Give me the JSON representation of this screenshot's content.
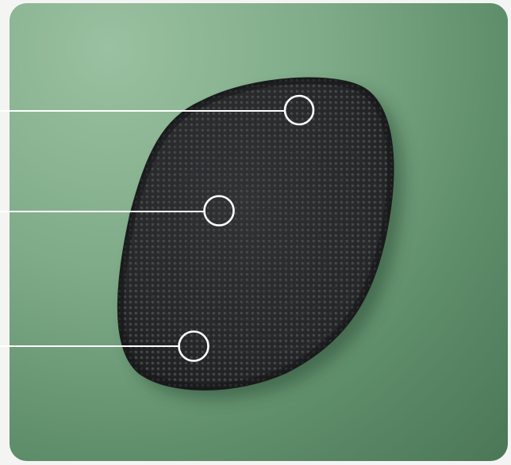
{
  "scene": {
    "subject": "scrubber-pad-icon",
    "colors": {
      "background_light": "#9ac1a1",
      "background_mid": "#7fab88",
      "background_dark": "#4b7757",
      "pad_face": "#2a2b2c",
      "pad_edge": "#1d1e1f",
      "bristle": "#3a3c3e",
      "bristle_highlight": "#5a5d60",
      "callout_line": "#ffffff"
    },
    "callouts": [
      {
        "marker": "circle-marker-icon"
      },
      {
        "marker": "circle-marker-icon"
      },
      {
        "marker": "circle-marker-icon"
      }
    ]
  }
}
